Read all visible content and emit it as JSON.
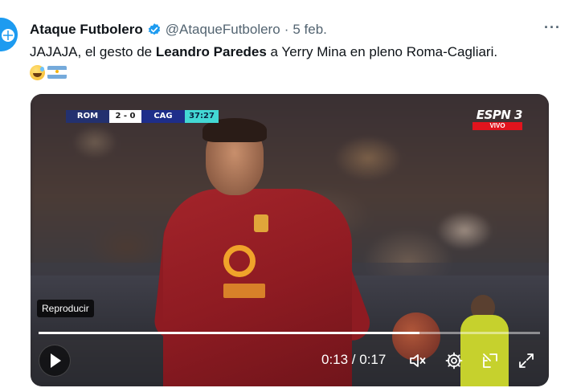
{
  "tweet": {
    "author_name": "Ataque Futbolero",
    "handle": "@AtaqueFutbolero",
    "separator": "·",
    "date": "5 feb.",
    "more_label": "···",
    "text_parts": [
      "JAJAJA, el gesto de ",
      "Leandro Paredes",
      " a Yerry Mina en pleno Roma-Cagliari."
    ]
  },
  "video": {
    "scorebug": {
      "team_home": "ROM",
      "score": "2 - 0",
      "team_away": "CAG",
      "clock": "37:27"
    },
    "broadcaster": {
      "logo_text": "ESPN 3",
      "live_label": "VIVO"
    },
    "tooltip": "Reproducir",
    "progress_fraction": 0.76,
    "timecode": "0:13 / 0:17"
  },
  "colors": {
    "verified": "#1d9bf0",
    "muted_text": "#536471",
    "espn_red": "#e1141d",
    "clock_cyan": "#43d8d4"
  }
}
